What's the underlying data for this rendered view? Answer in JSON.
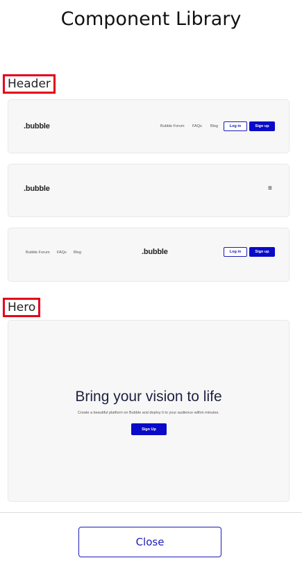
{
  "title": "Component Library",
  "sections": {
    "header_label": "Header",
    "hero_label": "Hero"
  },
  "header1": {
    "logo": ".bubble",
    "links": [
      "Bubble Forum",
      "FAQs",
      "Blog"
    ],
    "login": "Log in",
    "signup": "Sign up"
  },
  "header2": {
    "logo": ".bubble",
    "menu_icon": "hamburger-icon"
  },
  "header3": {
    "links": [
      "Bubble Forum",
      "FAQs",
      "Blog"
    ],
    "logo": ".bubble",
    "login": "Log in",
    "signup": "Sign up"
  },
  "hero": {
    "headline": "Bring your vision to life",
    "subtext": "Create a beautiful platform on Bubble and deploy it to your audience within minutes.",
    "cta": "Sign Up"
  },
  "footer": {
    "close": "Close"
  }
}
